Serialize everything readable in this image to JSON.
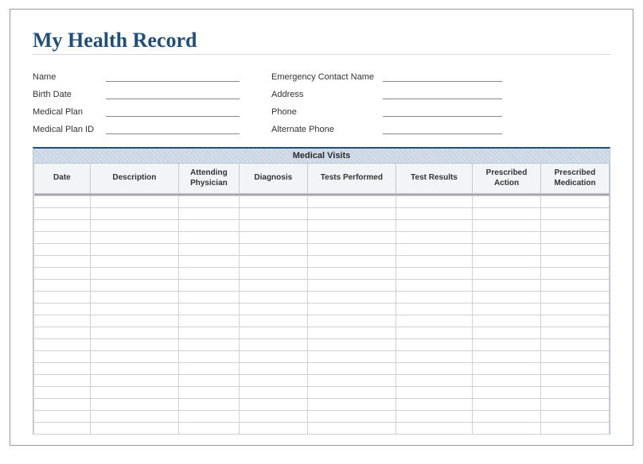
{
  "title": "My Health Record",
  "info_left": [
    {
      "label": "Name",
      "value": ""
    },
    {
      "label": "Birth Date",
      "value": ""
    },
    {
      "label": "Medical Plan",
      "value": ""
    },
    {
      "label": "Medical Plan ID",
      "value": ""
    }
  ],
  "info_right": [
    {
      "label": "Emergency Contact Name",
      "value": ""
    },
    {
      "label": "Address",
      "value": ""
    },
    {
      "label": "Phone",
      "value": ""
    },
    {
      "label": "Alternate Phone",
      "value": ""
    }
  ],
  "visits": {
    "title": "Medical Visits",
    "columns": [
      "Date",
      "Description",
      "Attending Physician",
      "Diagnosis",
      "Tests Performed",
      "Test Results",
      "Prescribed Action",
      "Prescribed Medication"
    ],
    "row_count": 20
  }
}
